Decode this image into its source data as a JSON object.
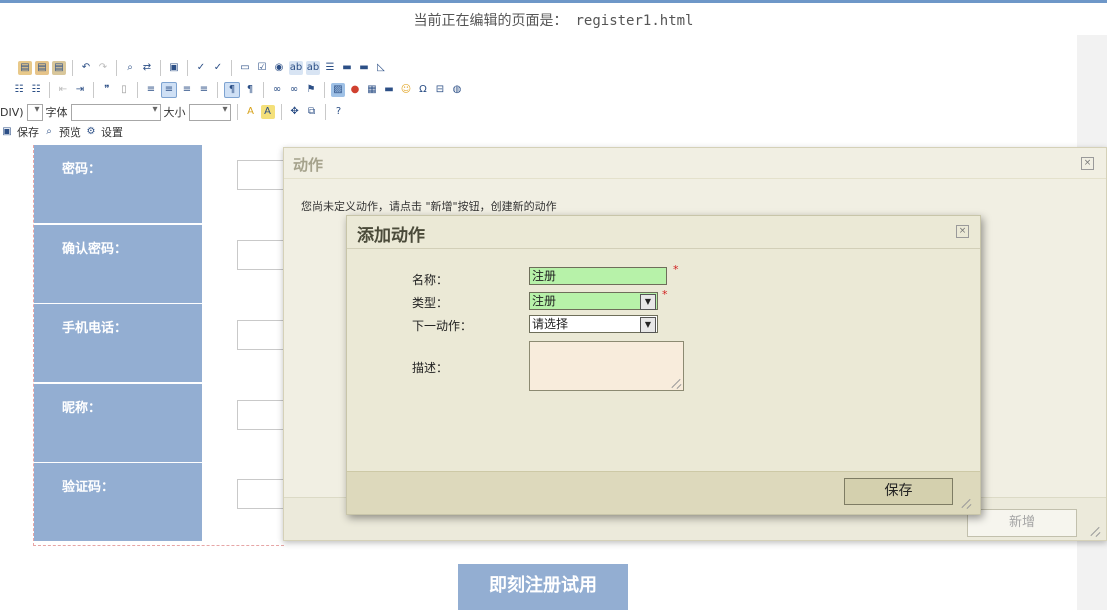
{
  "header": {
    "editing_prefix": "当前正在编辑的页面是：",
    "editing_file": "register1.html"
  },
  "toolbar": {
    "format_label": "DIV)",
    "font_label": "字体",
    "size_label": "大小",
    "save_label": "保存",
    "preview_label": "预览",
    "settings_label": "设置"
  },
  "form": {
    "rows": [
      {
        "label": "密码："
      },
      {
        "label": "确认密码："
      },
      {
        "label": "手机电话："
      },
      {
        "label": "昵称："
      },
      {
        "label": "验证码："
      }
    ],
    "register_button": "即刻注册试用"
  },
  "actions_dialog": {
    "title": "动作",
    "message": "您尚未定义动作，请点击 \"新增\"按钮，创建新的动作",
    "add_new_button": "新增"
  },
  "add_action_dialog": {
    "title": "添加动作",
    "fields": {
      "name_label": "名称：",
      "name_value": "注册",
      "type_label": "类型：",
      "type_value": "注册",
      "next_label": "下一动作：",
      "next_value": "请选择",
      "desc_label": "描述："
    },
    "required_mark": "*",
    "save_button": "保存"
  },
  "colors": {
    "form_row_bg": "#93aed2",
    "dialog_bg": "#ebe9d6",
    "required_field_bg": "#b7f2a9",
    "description_bg": "#f8ecdc",
    "top_border": "#6e97c8"
  }
}
